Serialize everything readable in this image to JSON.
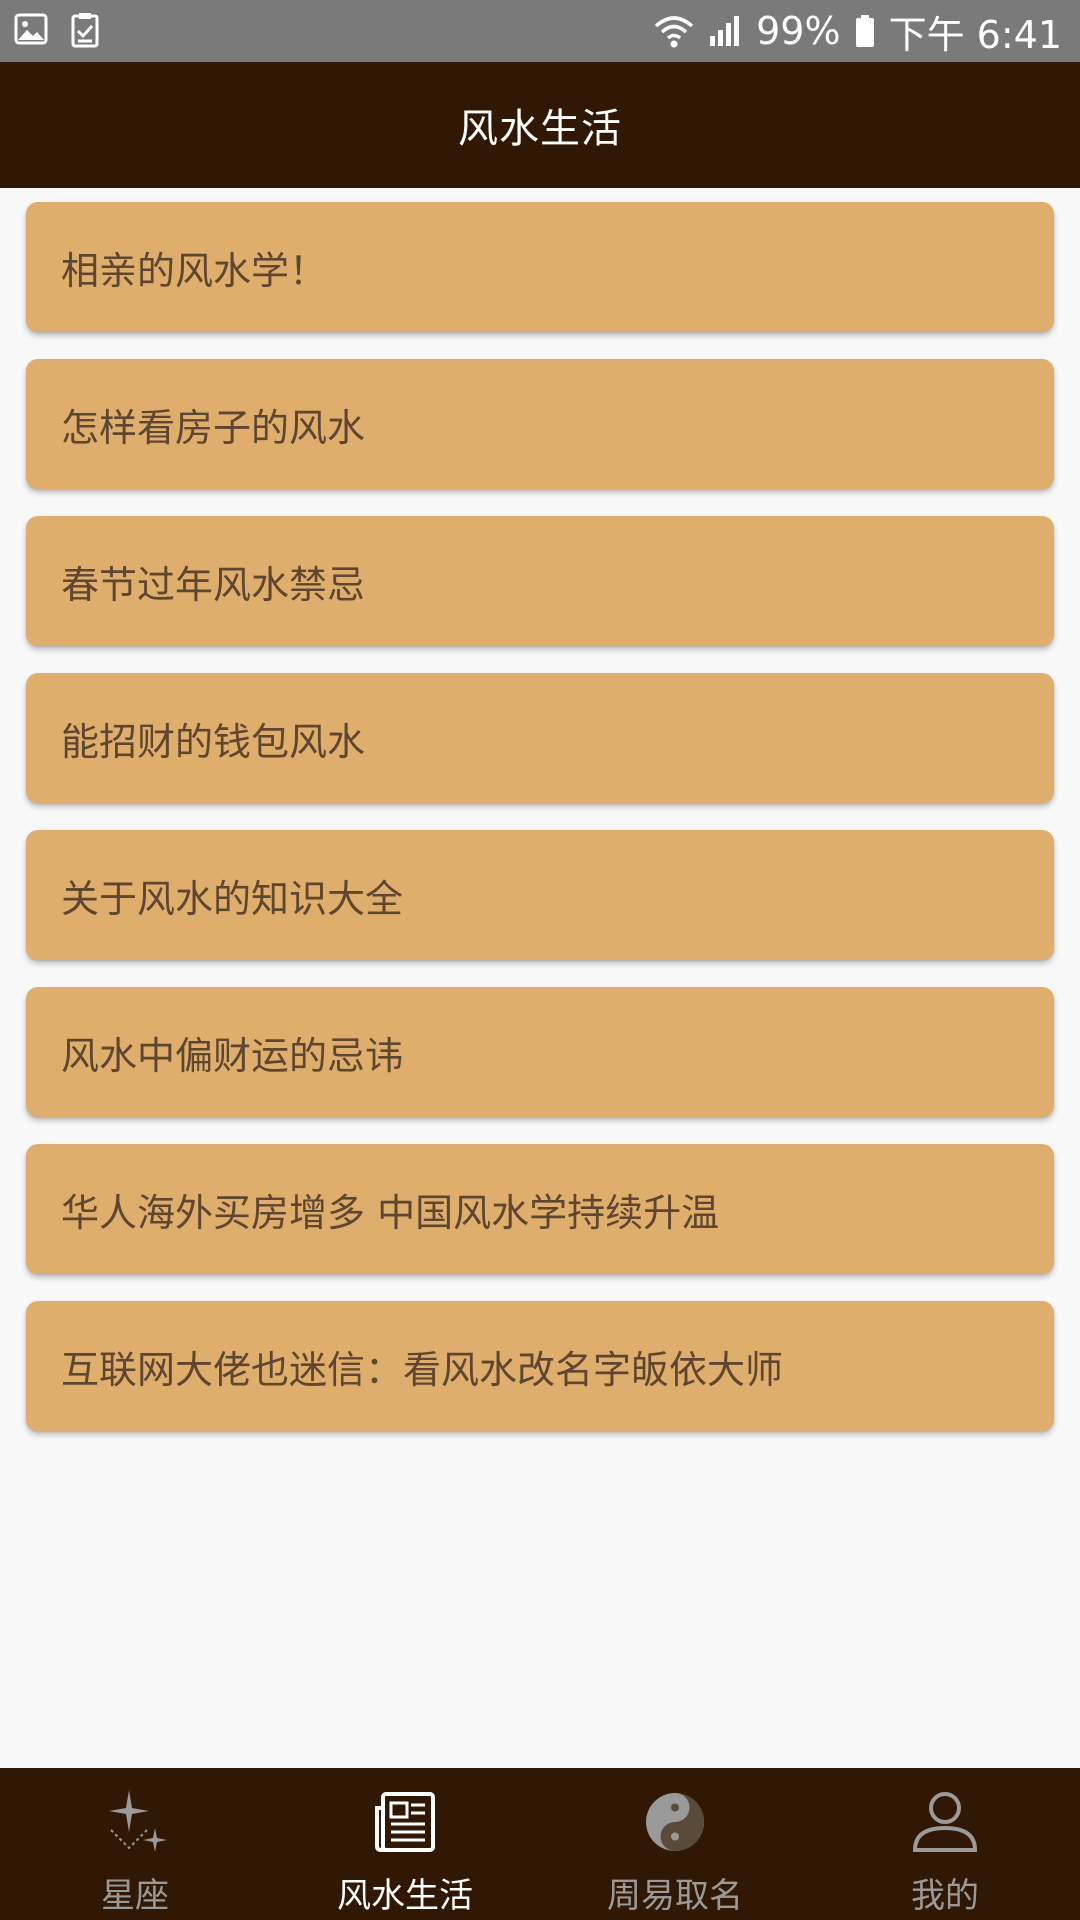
{
  "status_bar": {
    "battery": "99%",
    "time": "下午 6:41",
    "icons": [
      "image-icon",
      "clipboard-check-icon",
      "wifi-icon",
      "signal-icon",
      "battery-icon"
    ]
  },
  "app_bar": {
    "title": "风水生活"
  },
  "articles": [
    {
      "title": "相亲的风水学！"
    },
    {
      "title": "怎样看房子的风水"
    },
    {
      "title": "春节过年风水禁忌"
    },
    {
      "title": "能招财的钱包风水"
    },
    {
      "title": "关于风水的知识大全"
    },
    {
      "title": "风水中偏财运的忌讳"
    },
    {
      "title": "华人海外买房增多 中国风水学持续升温"
    },
    {
      "title": "互联网大佬也迷信：看风水改名字皈依大师"
    }
  ],
  "bottom_nav": {
    "active": "风水生活",
    "items": [
      {
        "label": "星座",
        "icon": "stars-icon"
      },
      {
        "label": "风水生活",
        "icon": "newspaper-icon"
      },
      {
        "label": "周易取名",
        "icon": "yin-yang-icon"
      },
      {
        "label": "我的",
        "icon": "user-icon"
      }
    ]
  },
  "colors": {
    "status_bar": "#7a7a7a",
    "app_bar": "#301804",
    "card": "#dfae6c",
    "card_text": "#5e4630",
    "background": "#f8f8f8",
    "nav_inactive": "#9a9a9a",
    "nav_active": "#ffffff"
  }
}
